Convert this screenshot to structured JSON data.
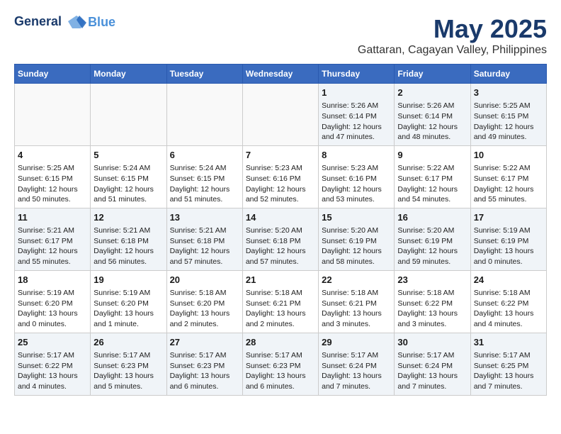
{
  "logo": {
    "line1": "General",
    "line2": "Blue"
  },
  "title": "May 2025",
  "subtitle": "Gattaran, Cagayan Valley, Philippines",
  "days_header": [
    "Sunday",
    "Monday",
    "Tuesday",
    "Wednesday",
    "Thursday",
    "Friday",
    "Saturday"
  ],
  "weeks": [
    [
      {
        "day": "",
        "info": ""
      },
      {
        "day": "",
        "info": ""
      },
      {
        "day": "",
        "info": ""
      },
      {
        "day": "",
        "info": ""
      },
      {
        "day": "1",
        "info": "Sunrise: 5:26 AM\nSunset: 6:14 PM\nDaylight: 12 hours\nand 47 minutes."
      },
      {
        "day": "2",
        "info": "Sunrise: 5:26 AM\nSunset: 6:14 PM\nDaylight: 12 hours\nand 48 minutes."
      },
      {
        "day": "3",
        "info": "Sunrise: 5:25 AM\nSunset: 6:15 PM\nDaylight: 12 hours\nand 49 minutes."
      }
    ],
    [
      {
        "day": "4",
        "info": "Sunrise: 5:25 AM\nSunset: 6:15 PM\nDaylight: 12 hours\nand 50 minutes."
      },
      {
        "day": "5",
        "info": "Sunrise: 5:24 AM\nSunset: 6:15 PM\nDaylight: 12 hours\nand 51 minutes."
      },
      {
        "day": "6",
        "info": "Sunrise: 5:24 AM\nSunset: 6:15 PM\nDaylight: 12 hours\nand 51 minutes."
      },
      {
        "day": "7",
        "info": "Sunrise: 5:23 AM\nSunset: 6:16 PM\nDaylight: 12 hours\nand 52 minutes."
      },
      {
        "day": "8",
        "info": "Sunrise: 5:23 AM\nSunset: 6:16 PM\nDaylight: 12 hours\nand 53 minutes."
      },
      {
        "day": "9",
        "info": "Sunrise: 5:22 AM\nSunset: 6:17 PM\nDaylight: 12 hours\nand 54 minutes."
      },
      {
        "day": "10",
        "info": "Sunrise: 5:22 AM\nSunset: 6:17 PM\nDaylight: 12 hours\nand 55 minutes."
      }
    ],
    [
      {
        "day": "11",
        "info": "Sunrise: 5:21 AM\nSunset: 6:17 PM\nDaylight: 12 hours\nand 55 minutes."
      },
      {
        "day": "12",
        "info": "Sunrise: 5:21 AM\nSunset: 6:18 PM\nDaylight: 12 hours\nand 56 minutes."
      },
      {
        "day": "13",
        "info": "Sunrise: 5:21 AM\nSunset: 6:18 PM\nDaylight: 12 hours\nand 57 minutes."
      },
      {
        "day": "14",
        "info": "Sunrise: 5:20 AM\nSunset: 6:18 PM\nDaylight: 12 hours\nand 57 minutes."
      },
      {
        "day": "15",
        "info": "Sunrise: 5:20 AM\nSunset: 6:19 PM\nDaylight: 12 hours\nand 58 minutes."
      },
      {
        "day": "16",
        "info": "Sunrise: 5:20 AM\nSunset: 6:19 PM\nDaylight: 12 hours\nand 59 minutes."
      },
      {
        "day": "17",
        "info": "Sunrise: 5:19 AM\nSunset: 6:19 PM\nDaylight: 13 hours\nand 0 minutes."
      }
    ],
    [
      {
        "day": "18",
        "info": "Sunrise: 5:19 AM\nSunset: 6:20 PM\nDaylight: 13 hours\nand 0 minutes."
      },
      {
        "day": "19",
        "info": "Sunrise: 5:19 AM\nSunset: 6:20 PM\nDaylight: 13 hours\nand 1 minute."
      },
      {
        "day": "20",
        "info": "Sunrise: 5:18 AM\nSunset: 6:20 PM\nDaylight: 13 hours\nand 2 minutes."
      },
      {
        "day": "21",
        "info": "Sunrise: 5:18 AM\nSunset: 6:21 PM\nDaylight: 13 hours\nand 2 minutes."
      },
      {
        "day": "22",
        "info": "Sunrise: 5:18 AM\nSunset: 6:21 PM\nDaylight: 13 hours\nand 3 minutes."
      },
      {
        "day": "23",
        "info": "Sunrise: 5:18 AM\nSunset: 6:22 PM\nDaylight: 13 hours\nand 3 minutes."
      },
      {
        "day": "24",
        "info": "Sunrise: 5:18 AM\nSunset: 6:22 PM\nDaylight: 13 hours\nand 4 minutes."
      }
    ],
    [
      {
        "day": "25",
        "info": "Sunrise: 5:17 AM\nSunset: 6:22 PM\nDaylight: 13 hours\nand 4 minutes."
      },
      {
        "day": "26",
        "info": "Sunrise: 5:17 AM\nSunset: 6:23 PM\nDaylight: 13 hours\nand 5 minutes."
      },
      {
        "day": "27",
        "info": "Sunrise: 5:17 AM\nSunset: 6:23 PM\nDaylight: 13 hours\nand 6 minutes."
      },
      {
        "day": "28",
        "info": "Sunrise: 5:17 AM\nSunset: 6:23 PM\nDaylight: 13 hours\nand 6 minutes."
      },
      {
        "day": "29",
        "info": "Sunrise: 5:17 AM\nSunset: 6:24 PM\nDaylight: 13 hours\nand 7 minutes."
      },
      {
        "day": "30",
        "info": "Sunrise: 5:17 AM\nSunset: 6:24 PM\nDaylight: 13 hours\nand 7 minutes."
      },
      {
        "day": "31",
        "info": "Sunrise: 5:17 AM\nSunset: 6:25 PM\nDaylight: 13 hours\nand 7 minutes."
      }
    ]
  ]
}
